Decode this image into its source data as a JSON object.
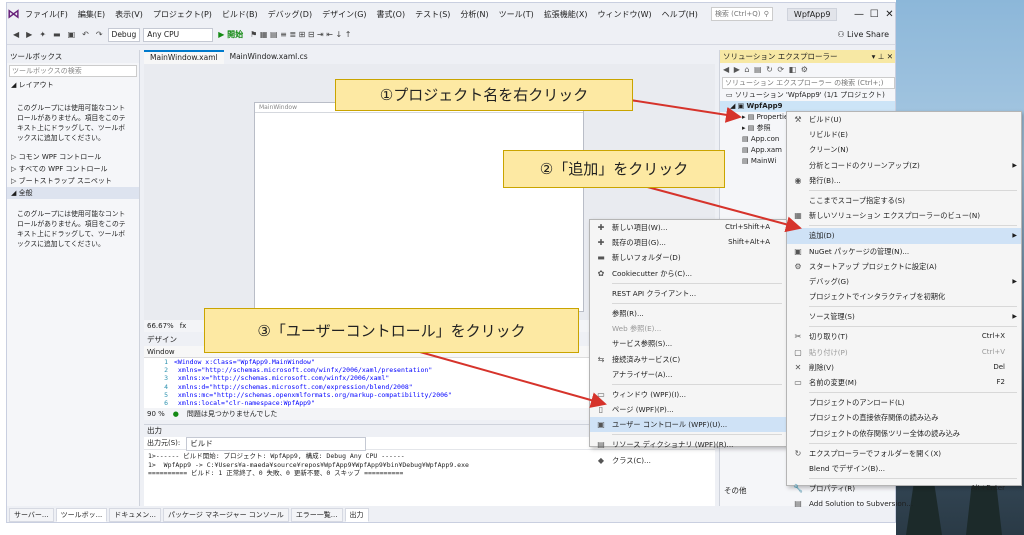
{
  "menubar": {
    "items": [
      "ファイル(F)",
      "編集(E)",
      "表示(V)",
      "プロジェクト(P)",
      "ビルド(B)",
      "デバッグ(D)",
      "デザイン(G)",
      "書式(O)",
      "テスト(S)",
      "分析(N)",
      "ツール(T)",
      "拡張機能(X)",
      "ウィンドウ(W)",
      "ヘルプ(H)"
    ],
    "search_placeholder": "検索 (Ctrl+Q)",
    "app_name": "WpfApp9"
  },
  "toolbar": {
    "config": "Debug",
    "platform": "Any CPU",
    "start": "▶ 開始",
    "live_share": "Live Share"
  },
  "toolbox": {
    "title": "ツールボックス",
    "search_placeholder": "ツールボックスの検索",
    "layout_group": "◢ レイアウト",
    "empty_msg": "このグループには使用可能なコントロールがありません。項目をこのテキスト上にドラッグして、ツールボックスに追加してください。",
    "groups": [
      "▷ コモン WPF コントロール",
      "▷ すべての WPF コントロール",
      "▷ ブートストラップ スニペット",
      "◢ 全般"
    ]
  },
  "doc_tabs": [
    "MainWindow.xaml",
    "MainWindow.xaml.cs"
  ],
  "designer": {
    "window_title": "MainWindow",
    "zoom": "66.67%",
    "tab_design": "デザイン",
    "crumb": "Window"
  },
  "code_lines": [
    {
      "n": "1",
      "text": "<Window x:Class=\"WpfApp9.MainWindow\""
    },
    {
      "n": "2",
      "text": "        xmlns=\"http://schemas.microsoft.com/winfx/2006/xaml/presentation\""
    },
    {
      "n": "3",
      "text": "        xmlns:x=\"http://schemas.microsoft.com/winfx/2006/xaml\""
    },
    {
      "n": "4",
      "text": "        xmlns:d=\"http://schemas.microsoft.com/expression/blend/2008\""
    },
    {
      "n": "5",
      "text": "        xmlns:mc=\"http://schemas.openxmlformats.org/markup-compatibility/2006\""
    },
    {
      "n": "6",
      "text": "        xmlns:local=\"clr-namespace:WpfApp9\""
    }
  ],
  "code_status": {
    "zoom": "90 %",
    "message": "問題は見つかりませんでした"
  },
  "output": {
    "title": "出力",
    "source_label": "出力元(S):",
    "source_value": "ビルド",
    "lines": [
      "1>------ ビルド開始: プロジェクト: WpfApp9, 構成: Debug Any CPU ------",
      "1>  WpfApp9 -> C:¥Users¥a-maeda¥source¥repos¥WpfApp9¥WpfApp9¥bin¥Debug¥WpfApp9.exe",
      "========== ビルド: 1 正常終了、0 失敗、0 更新不要、0 スキップ =========="
    ]
  },
  "bottom_tabs": [
    "サーバー...",
    "ツールボッ...",
    "ドキュメン...",
    "パッケージ マネージャー コンソール",
    "エラー一覧...",
    "出力"
  ],
  "solution": {
    "title": "ソリューション エクスプローラー",
    "search_placeholder": "ソリューション エクスプローラー の検索 (Ctrl+;)",
    "solution_node": "ソリューション 'WpfApp9' (1/1 プロジェクト)",
    "project_node": "WpfApp9",
    "children": [
      "Properties",
      "参照",
      "App.con",
      "App.xam",
      "MainWi"
    ],
    "other": "その他"
  },
  "context_main": [
    {
      "icon": "⚒",
      "label": "ビルド(U)"
    },
    {
      "label": "リビルド(E)"
    },
    {
      "label": "クリーン(N)"
    },
    {
      "label": "分析とコードのクリーンアップ(Z)",
      "arrow": true
    },
    {
      "icon": "◉",
      "label": "発行(B)..."
    },
    {
      "sep": true
    },
    {
      "label": "ここまでスコープ指定する(S)"
    },
    {
      "icon": "▦",
      "label": "新しいソリューション エクスプローラーのビュー(N)"
    },
    {
      "sep": true
    },
    {
      "label": "追加(D)",
      "arrow": true,
      "hl": true
    },
    {
      "icon": "▣",
      "label": "NuGet パッケージの管理(N)..."
    },
    {
      "icon": "⚙",
      "label": "スタートアップ プロジェクトに設定(A)"
    },
    {
      "label": "デバッグ(G)",
      "arrow": true
    },
    {
      "label": "プロジェクトでインタラクティブを初期化"
    },
    {
      "sep": true
    },
    {
      "label": "ソース管理(S)",
      "arrow": true
    },
    {
      "sep": true
    },
    {
      "icon": "✂",
      "label": "切り取り(T)",
      "shortcut": "Ctrl+X"
    },
    {
      "icon": "▢",
      "label": "貼り付け(P)",
      "shortcut": "Ctrl+V",
      "dis": true
    },
    {
      "icon": "✕",
      "label": "削除(V)",
      "shortcut": "Del"
    },
    {
      "icon": "▭",
      "label": "名前の変更(M)",
      "shortcut": "F2"
    },
    {
      "sep": true
    },
    {
      "label": "プロジェクトのアンロード(L)"
    },
    {
      "label": "プロジェクトの直接依存関係の読み込み"
    },
    {
      "label": "プロジェクトの依存関係ツリー全体の読み込み"
    },
    {
      "sep": true
    },
    {
      "icon": "↻",
      "label": "エクスプローラーでフォルダーを開く(X)"
    },
    {
      "label": "Blend でデザイン(B)..."
    },
    {
      "sep": true
    },
    {
      "icon": "🔧",
      "label": "プロパティ(R)",
      "shortcut": "Alt+Enter"
    },
    {
      "icon": "▤",
      "label": "Add Solution to Subversion..."
    }
  ],
  "context_add": [
    {
      "icon": "✚",
      "label": "新しい項目(W)...",
      "shortcut": "Ctrl+Shift+A"
    },
    {
      "icon": "✚",
      "label": "既存の項目(G)...",
      "shortcut": "Shift+Alt+A"
    },
    {
      "icon": "▬",
      "label": "新しいフォルダー(D)"
    },
    {
      "icon": "✿",
      "label": "Cookiecutter から(C)..."
    },
    {
      "sep": true
    },
    {
      "label": "REST API クライアント..."
    },
    {
      "sep": true
    },
    {
      "label": "参照(R)..."
    },
    {
      "label": "Web 参照(E)...",
      "dis": true
    },
    {
      "label": "サービス参照(S)..."
    },
    {
      "icon": "⇆",
      "label": "接続済みサービス(C)"
    },
    {
      "label": "アナライザー(A)..."
    },
    {
      "sep": true
    },
    {
      "icon": "▭",
      "label": "ウィンドウ (WPF)(I)..."
    },
    {
      "icon": "▯",
      "label": "ページ (WPF)(P)..."
    },
    {
      "icon": "▣",
      "label": "ユーザー コントロール (WPF)(U)...",
      "hl": true
    },
    {
      "sep": true
    },
    {
      "icon": "▤",
      "label": "リソース ディクショナリ (WPF)(R)..."
    },
    {
      "icon": "◆",
      "label": "クラス(C)..."
    }
  ],
  "callouts": {
    "c1": "①プロジェクト名を右クリック",
    "c2": "②「追加」をクリック",
    "c3": "③「ユーザーコントロール」をクリック"
  },
  "colors": {
    "accent": "#007acc",
    "callout_bg": "#fde9a3",
    "arrow": "#d6332b",
    "highlight": "#cfe2f6"
  }
}
